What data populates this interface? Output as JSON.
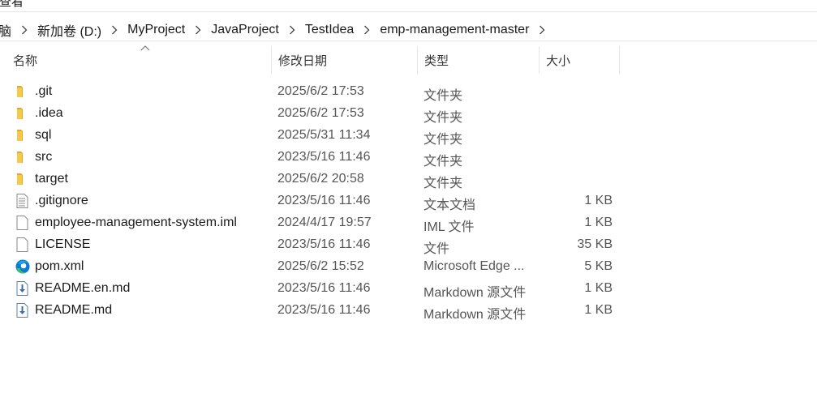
{
  "window": {
    "menu_fragment": "查看"
  },
  "breadcrumb": {
    "items": [
      {
        "label": "脑"
      },
      {
        "label": "新加卷 (D:)"
      },
      {
        "label": "MyProject"
      },
      {
        "label": "JavaProject"
      },
      {
        "label": "TestIdea"
      },
      {
        "label": "emp-management-master"
      }
    ]
  },
  "columns": {
    "name": "名称",
    "date": "修改日期",
    "type": "类型",
    "size": "大小"
  },
  "files": [
    {
      "name": ".git",
      "date": "2025/6/2 17:53",
      "type": "文件夹",
      "size": "",
      "icon": "folder-icon"
    },
    {
      "name": ".idea",
      "date": "2025/6/2 17:53",
      "type": "文件夹",
      "size": "",
      "icon": "folder-icon"
    },
    {
      "name": "sql",
      "date": "2025/5/31 11:34",
      "type": "文件夹",
      "size": "",
      "icon": "folder-icon"
    },
    {
      "name": "src",
      "date": "2023/5/16 11:46",
      "type": "文件夹",
      "size": "",
      "icon": "folder-icon"
    },
    {
      "name": "target",
      "date": "2025/6/2 20:58",
      "type": "文件夹",
      "size": "",
      "icon": "folder-icon"
    },
    {
      "name": ".gitignore",
      "date": "2023/5/16 11:46",
      "type": "文本文档",
      "size": "1 KB",
      "icon": "text-file-icon"
    },
    {
      "name": "employee-management-system.iml",
      "date": "2024/4/17 19:57",
      "type": "IML 文件",
      "size": "1 KB",
      "icon": "file-icon"
    },
    {
      "name": "LICENSE",
      "date": "2023/5/16 11:46",
      "type": "文件",
      "size": "35 KB",
      "icon": "file-icon"
    },
    {
      "name": "pom.xml",
      "date": "2025/6/2 15:52",
      "type": "Microsoft Edge ...",
      "size": "5 KB",
      "icon": "edge-icon"
    },
    {
      "name": "README.en.md",
      "date": "2023/5/16 11:46",
      "type": "Markdown 源文件",
      "size": "1 KB",
      "icon": "markdown-file-icon"
    },
    {
      "name": "README.md",
      "date": "2023/5/16 11:46",
      "type": "Markdown 源文件",
      "size": "1 KB",
      "icon": "markdown-file-icon"
    }
  ],
  "colors": {
    "folder": "#f8c84a",
    "edge_blue": "#0c7bd8",
    "edge_green": "#3ec16b",
    "divider": "#e5e5e5"
  }
}
